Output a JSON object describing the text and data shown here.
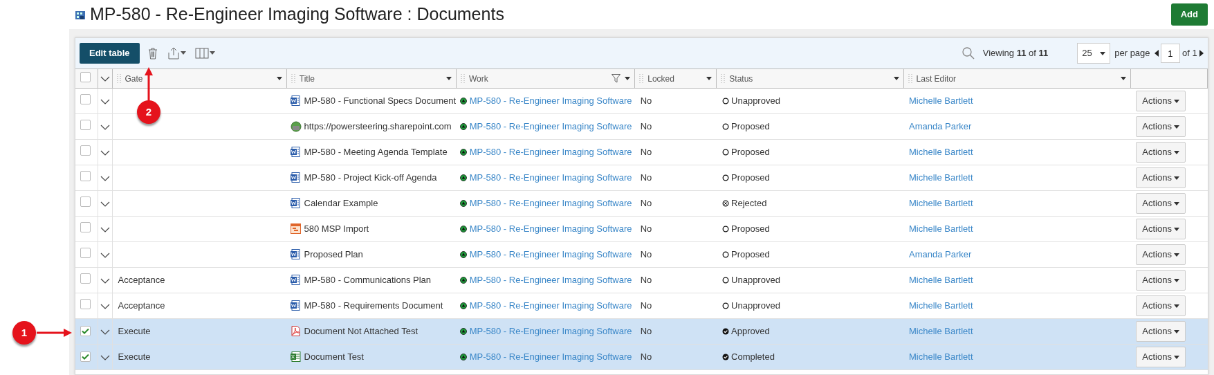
{
  "page": {
    "title": "MP-580 - Re-Engineer Imaging Software : Documents",
    "add_button": "Add"
  },
  "toolbar": {
    "edit_button": "Edit table",
    "viewing_prefix": "Viewing",
    "viewing_count": "11",
    "viewing_of": "of",
    "viewing_total": "11",
    "page_size": "25",
    "per_page": "per page",
    "page": "1",
    "page_of": "of 1"
  },
  "table": {
    "all_selected": false,
    "columns": [
      {
        "label": "Gate"
      },
      {
        "label": "Title"
      },
      {
        "label": "Work",
        "filter": true
      },
      {
        "label": "Locked"
      },
      {
        "label": "Status"
      },
      {
        "label": "Last Editor"
      }
    ],
    "rows": [
      {
        "selected": false,
        "gate": "",
        "title": {
          "kind": "word",
          "text": "MP-580 - Functional Specs Document"
        },
        "work": "MP-580 - Re-Engineer Imaging Software",
        "locked": "No",
        "status": {
          "kind": "open",
          "text": "Unapproved"
        },
        "editor": "Michelle Bartlett",
        "action": "Actions"
      },
      {
        "selected": false,
        "gate": "",
        "title": {
          "kind": "web",
          "text": "https://powersteering.sharepoint.com"
        },
        "work": "MP-580 - Re-Engineer Imaging Software",
        "locked": "No",
        "status": {
          "kind": "open",
          "text": "Proposed"
        },
        "editor": "Amanda Parker",
        "action": "Actions"
      },
      {
        "selected": false,
        "gate": "",
        "title": {
          "kind": "word",
          "text": "MP-580 - Meeting Agenda Template"
        },
        "work": "MP-580 - Re-Engineer Imaging Software",
        "locked": "No",
        "status": {
          "kind": "open",
          "text": "Proposed"
        },
        "editor": "Michelle Bartlett",
        "action": "Actions"
      },
      {
        "selected": false,
        "gate": "",
        "title": {
          "kind": "word",
          "text": "MP-580 - Project Kick-off Agenda"
        },
        "work": "MP-580 - Re-Engineer Imaging Software",
        "locked": "No",
        "status": {
          "kind": "open",
          "text": "Proposed"
        },
        "editor": "Michelle Bartlett",
        "action": "Actions"
      },
      {
        "selected": false,
        "gate": "",
        "title": {
          "kind": "word",
          "text": "Calendar Example"
        },
        "work": "MP-580 - Re-Engineer Imaging Software",
        "locked": "No",
        "status": {
          "kind": "rejected",
          "text": "Rejected"
        },
        "editor": "Michelle Bartlett",
        "action": "Actions"
      },
      {
        "selected": false,
        "gate": "",
        "title": {
          "kind": "project",
          "text": "580 MSP Import"
        },
        "work": "MP-580 - Re-Engineer Imaging Software",
        "locked": "No",
        "status": {
          "kind": "open",
          "text": "Proposed"
        },
        "editor": "Michelle Bartlett",
        "action": "Actions"
      },
      {
        "selected": false,
        "gate": "",
        "title": {
          "kind": "word",
          "text": "Proposed Plan"
        },
        "work": "MP-580 - Re-Engineer Imaging Software",
        "locked": "No",
        "status": {
          "kind": "open",
          "text": "Proposed"
        },
        "editor": "Amanda Parker",
        "action": "Actions"
      },
      {
        "selected": false,
        "gate": "Acceptance",
        "title": {
          "kind": "word",
          "text": "MP-580 - Communications Plan"
        },
        "work": "MP-580 - Re-Engineer Imaging Software",
        "locked": "No",
        "status": {
          "kind": "open",
          "text": "Unapproved"
        },
        "editor": "Michelle Bartlett",
        "action": "Actions"
      },
      {
        "selected": false,
        "gate": "Acceptance",
        "title": {
          "kind": "word",
          "text": "MP-580 - Requirements Document"
        },
        "work": "MP-580 - Re-Engineer Imaging Software",
        "locked": "No",
        "status": {
          "kind": "open",
          "text": "Unapproved"
        },
        "editor": "Michelle Bartlett",
        "action": "Actions"
      },
      {
        "selected": true,
        "gate": "Execute",
        "title": {
          "kind": "pdf",
          "text": "Document Not Attached Test"
        },
        "work": "MP-580 - Re-Engineer Imaging Software",
        "locked": "No",
        "status": {
          "kind": "done",
          "text": "Approved"
        },
        "editor": "Michelle Bartlett",
        "action": "Actions"
      },
      {
        "selected": true,
        "gate": "Execute",
        "title": {
          "kind": "excel",
          "text": "Document Test"
        },
        "work": "MP-580 - Re-Engineer Imaging Software",
        "locked": "No",
        "status": {
          "kind": "done",
          "text": "Completed"
        },
        "editor": "Michelle Bartlett",
        "action": "Actions"
      }
    ]
  },
  "callouts": [
    {
      "label": "1"
    },
    {
      "label": "2"
    }
  ]
}
